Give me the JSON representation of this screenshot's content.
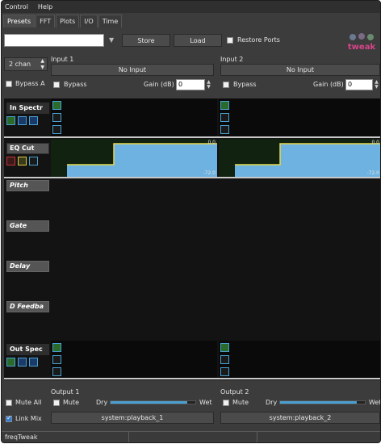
{
  "menubar": {
    "items": [
      "Control",
      "Help"
    ]
  },
  "tabs": [
    {
      "label": "Presets",
      "active": true
    },
    {
      "label": "FFT",
      "active": false
    },
    {
      "label": "Plots",
      "active": false
    },
    {
      "label": "I/O",
      "active": false
    },
    {
      "label": "Time",
      "active": false
    }
  ],
  "presets": {
    "name_value": "",
    "store_label": "Store",
    "load_label": "Load",
    "restore_ports_label": "Restore Ports",
    "restore_ports_checked": false
  },
  "logo": {
    "text": "tweak"
  },
  "channels": {
    "count_label": "2 chan",
    "bypass_all_label": "Bypass A",
    "bypass_all_checked": false
  },
  "inputs": [
    {
      "title": "Input 1",
      "port": "No Input",
      "bypass_label": "Bypass",
      "bypass_checked": false,
      "gain_label": "Gain (dB)",
      "gain_value": "0"
    },
    {
      "title": "Input 2",
      "port": "No Input",
      "bypass_label": "Bypass",
      "bypass_checked": false,
      "gain_label": "Gain (dB)",
      "gain_value": "0"
    }
  ],
  "plugins": {
    "in_spectrum": "In Spectr",
    "eq_cut": "EQ Cut",
    "pitch": "Pitch",
    "gate": "Gate",
    "delay": "Delay",
    "delay_feedback": "D Feedba",
    "out_spectrum": "Out Spec",
    "eq_top_label": "0.0",
    "eq_bottom_label": "-72.0"
  },
  "outputs": {
    "mute_all_label": "Mute All",
    "mute_all_checked": false,
    "link_mix_label": "Link Mix",
    "link_mix_checked": true,
    "channels": [
      {
        "title": "Output 1",
        "mute_label": "Mute",
        "mute_checked": false,
        "dry_label": "Dry",
        "wet_label": "Wet",
        "mix_level": 0.9,
        "port": "system:playback_1"
      },
      {
        "title": "Output 2",
        "mute_label": "Mute",
        "mute_checked": false,
        "dry_label": "Dry",
        "wet_label": "Wet",
        "mix_level": 0.9,
        "port": "system:playback_2"
      }
    ]
  },
  "status": {
    "app_name": "freqTweak"
  },
  "colors": {
    "accent": "#4aa0d0",
    "eq_fill": "#6db2e0",
    "eq_line": "#e6d84a"
  }
}
